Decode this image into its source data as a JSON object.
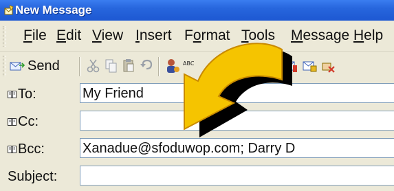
{
  "window": {
    "title": "New Message"
  },
  "menu": {
    "items": [
      {
        "label": "File",
        "accel": "F",
        "rest": "ile"
      },
      {
        "label": "Edit",
        "accel": "E",
        "rest": "dit"
      },
      {
        "label": "View",
        "accel": "V",
        "rest": "iew"
      },
      {
        "label": "Insert",
        "accel": "I",
        "rest": "nsert"
      },
      {
        "label": "Format",
        "pre": "F",
        "accel": "o",
        "rest": "rmat"
      },
      {
        "label": "Tools",
        "accel": "T",
        "rest": "ools"
      },
      {
        "label": "Message",
        "accel": "M",
        "rest": "essage"
      },
      {
        "label": "Help",
        "accel": "H",
        "rest": "elp"
      }
    ]
  },
  "toolbar": {
    "send_label": "Send",
    "icons": [
      "send-icon",
      "cut-icon",
      "copy-icon",
      "paste-icon",
      "undo-icon",
      "check-names-icon",
      "spelling-icon",
      "attach-icon",
      "priority-icon",
      "sign-icon",
      "encrypt-icon"
    ]
  },
  "fields": {
    "to": {
      "label": "To:",
      "value": "My Friend"
    },
    "cc": {
      "label": "Cc:",
      "value": ""
    },
    "bcc": {
      "label": "Bcc:",
      "value": "Xanadue@sfoduwop.com; Darry D"
    },
    "subject": {
      "label": "Subject:",
      "value": ""
    }
  },
  "colors": {
    "titlebar": "#2766dd",
    "arrow_fill": "#f5c400",
    "arrow_outline": "#c98a00",
    "arrow_shadow": "#000000"
  }
}
